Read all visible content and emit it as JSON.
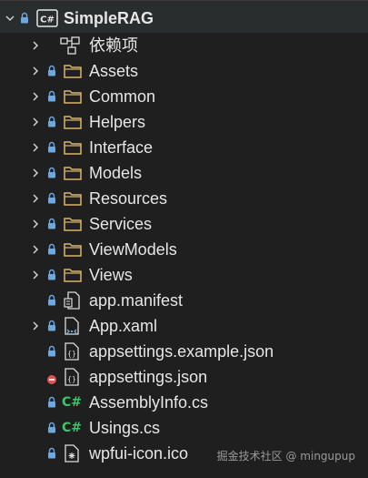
{
  "solution_explorer": {
    "project": {
      "name": "SimpleRAG",
      "language_badge": "C#",
      "expanded": true
    },
    "dependencies": {
      "label": "依赖项",
      "icon": "dependencies-icon"
    },
    "folders": [
      {
        "label": "Assets"
      },
      {
        "label": "Common"
      },
      {
        "label": "Helpers"
      },
      {
        "label": "Interface"
      },
      {
        "label": "Models"
      },
      {
        "label": "Resources"
      },
      {
        "label": "Services"
      },
      {
        "label": "ViewModels"
      },
      {
        "label": "Views"
      }
    ],
    "files": [
      {
        "label": "app.manifest",
        "icon": "manifest-file-icon"
      },
      {
        "label": "App.xaml",
        "icon": "xaml-file-icon"
      },
      {
        "label": "appsettings.example.json",
        "icon": "json-file-icon"
      },
      {
        "label": "appsettings.json",
        "icon": "json-file-icon",
        "status": "excluded"
      },
      {
        "label": "AssemblyInfo.cs",
        "icon": "csharp-file-icon"
      },
      {
        "label": "Usings.cs",
        "icon": "csharp-file-icon"
      },
      {
        "label": "wpfui-icon.ico",
        "icon": "ico-file-icon"
      }
    ]
  },
  "colors": {
    "background": "#1f1f1f",
    "selection": "#2a2d2e",
    "lock": "#6ea8e0",
    "excluded": "#e05252",
    "folder": "#d7b36e",
    "csharp": "#3fc46b"
  },
  "watermark": "掘金技术社区 @ mingupup"
}
